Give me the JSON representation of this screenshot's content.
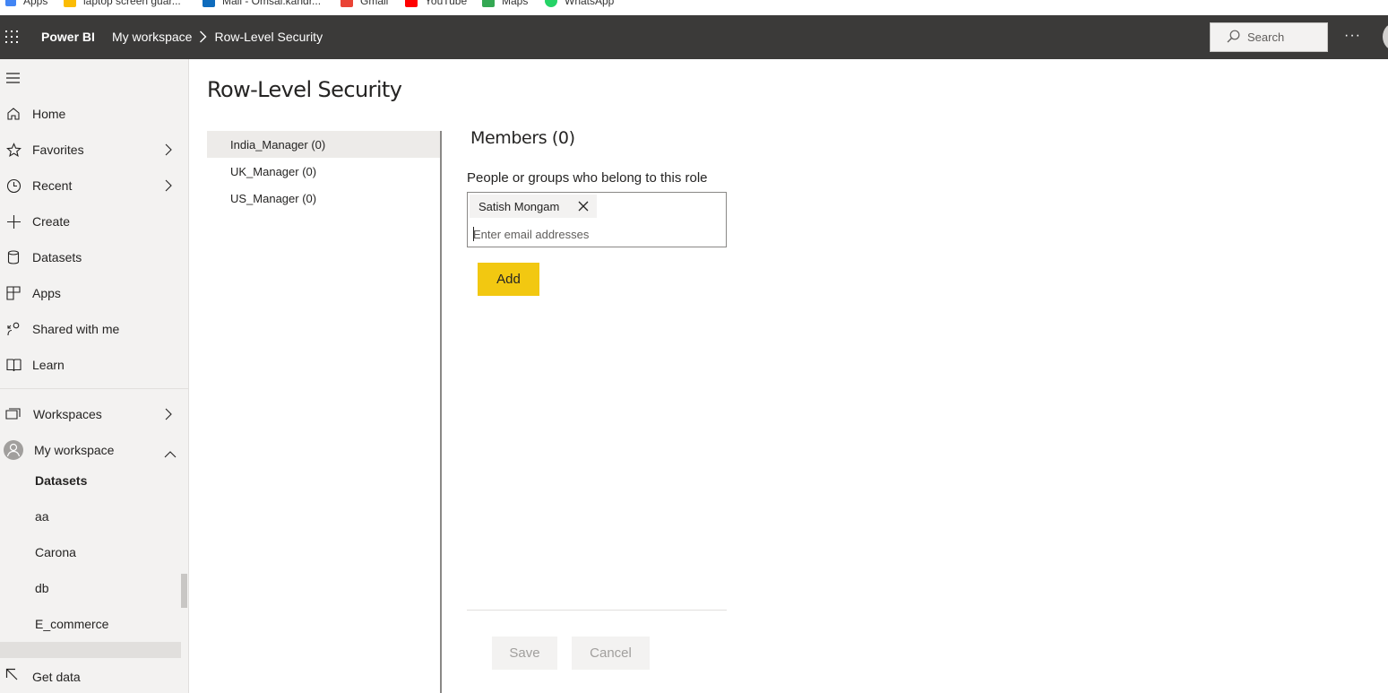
{
  "bookmarks": [
    {
      "label": "Apps",
      "color": "#4285f4"
    },
    {
      "label": "laptop screen guar...",
      "color": "#fbbc05"
    },
    {
      "label": "Mail - Omsai.kandr...",
      "color": "#0f6cbd"
    },
    {
      "label": "Gmail",
      "color": "#ea4335"
    },
    {
      "label": "YouTube",
      "color": "#ff0000"
    },
    {
      "label": "Maps",
      "color": "#34a853"
    },
    {
      "label": "WhatsApp",
      "color": "#25d366"
    }
  ],
  "header": {
    "brand": "Power BI",
    "breadcrumb": [
      "My workspace",
      "Row-Level Security"
    ],
    "search_label": "Search",
    "more": "···"
  },
  "nav": {
    "items": [
      {
        "label": "Home",
        "icon": "home-icon"
      },
      {
        "label": "Favorites",
        "icon": "star-icon"
      },
      {
        "label": "Recent",
        "icon": "clock-icon"
      },
      {
        "label": "Create",
        "icon": "plus-icon"
      },
      {
        "label": "Datasets",
        "icon": "database-icon"
      },
      {
        "label": "Apps",
        "icon": "apps-icon"
      },
      {
        "label": "Shared with me",
        "icon": "shared-icon"
      },
      {
        "label": "Learn",
        "icon": "book-icon"
      }
    ],
    "workspaces": "Workspaces",
    "my_workspace": "My workspace",
    "sub_items": [
      "Datasets",
      "aa",
      "Carona",
      "db",
      "E_commerce"
    ],
    "get_data": "Get data"
  },
  "main": {
    "title": "Row-Level Security",
    "roles": [
      "India_Manager (0)",
      "UK_Manager (0)",
      "US_Manager (0)"
    ],
    "members_title": "Members (0)",
    "members_desc": "People or groups who belong to this role",
    "chip": "Satish Mongam",
    "email_placeholder": "Enter email addresses",
    "add": "Add",
    "save": "Save",
    "cancel": "Cancel"
  },
  "colors": {
    "accent": "#f2c811",
    "header": "#3b3a39",
    "nav_bg": "#f3f2f1"
  }
}
